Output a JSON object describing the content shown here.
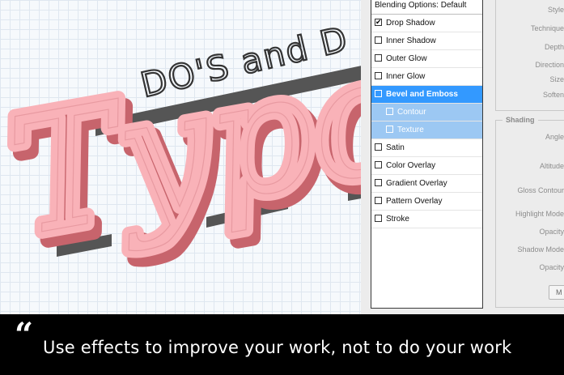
{
  "artwork": {
    "headline_line1": "DO'S and D",
    "headline_big": "Typog"
  },
  "layer_style": {
    "header": "Blending Options: Default",
    "items": [
      {
        "label": "Drop Shadow",
        "checked": true
      },
      {
        "label": "Inner Shadow",
        "checked": false
      },
      {
        "label": "Outer Glow",
        "checked": false
      },
      {
        "label": "Inner Glow",
        "checked": false
      },
      {
        "label": "Bevel and Emboss",
        "checked": false
      },
      {
        "label": "Contour",
        "checked": false
      },
      {
        "label": "Texture",
        "checked": false
      },
      {
        "label": "Satin",
        "checked": false
      },
      {
        "label": "Color Overlay",
        "checked": false
      },
      {
        "label": "Gradient Overlay",
        "checked": false
      },
      {
        "label": "Pattern Overlay",
        "checked": false
      },
      {
        "label": "Stroke",
        "checked": false
      }
    ],
    "structure_labels": [
      "Style",
      "Technique",
      "Depth",
      "Direction",
      "Size",
      "Soften"
    ],
    "shading_legend": "Shading",
    "shading_labels": [
      "Angle",
      "Altitude",
      "Gloss Contour",
      "Highlight Mode",
      "Opacity",
      "Shadow Mode",
      "Opacity"
    ],
    "button_label": "M",
    "check_mark": "✔"
  },
  "caption": {
    "quote": "“",
    "text": "Use effects to improve your work, not to do your work"
  },
  "colors": {
    "selected": "#3399ff",
    "sub_selected": "#9cc8f3",
    "script_pink": "#f9b2b8",
    "script_shadow": "#c7646c"
  }
}
